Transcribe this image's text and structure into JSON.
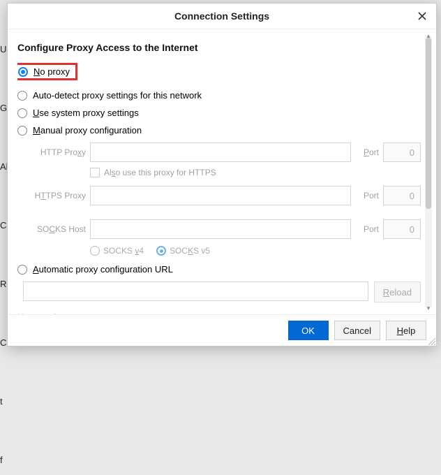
{
  "bg": "Us\n\nG\n\nAl\n\nC\n\nR\n\nC\n\nt\n\nf",
  "dialog": {
    "title": "Connection Settings",
    "section_heading": "Configure Proxy Access to the Internet",
    "options": {
      "no_proxy_prefix": "N",
      "no_proxy_rest": "o proxy",
      "autodetect": "Auto-detect proxy settings for this network",
      "system_prefix": "U",
      "system_rest": "se system proxy settings",
      "manual_prefix": "M",
      "manual_rest": "anual proxy configuration",
      "auto_url_prefix": "A",
      "auto_url_rest": "utomatic proxy configuration URL"
    },
    "labels": {
      "http_proxy_prefix": "HTTP Pro",
      "http_proxy_u": "x",
      "http_proxy_suffix": "y",
      "port_prefix": "P",
      "port_rest": "ort",
      "also_https": "Al",
      "also_https_u": "s",
      "also_https_rest": "o use this proxy for HTTPS",
      "https_proxy_prefix": "H",
      "https_proxy_u": "T",
      "https_proxy_rest": "TPS Proxy",
      "socks_prefix": "SO",
      "socks_u": "C",
      "socks_rest": "KS Host",
      "socks_v4": "SOCKS ",
      "socks_v4_u": "v",
      "socks_v4_rest": "4",
      "socks_v5_pre": "SOC",
      "socks_v5_u": "K",
      "socks_v5_rest": "S v5",
      "reload": "R",
      "reload_rest": "eload",
      "no_proxy_for_prefix": "N",
      "no_proxy_for_rest": "o proxy for"
    },
    "values": {
      "http_port": "0",
      "https_port": "0",
      "socks_port": "0"
    },
    "footer": {
      "ok": "OK",
      "cancel": "Cancel",
      "help_prefix": "H",
      "help_rest": "elp"
    }
  }
}
